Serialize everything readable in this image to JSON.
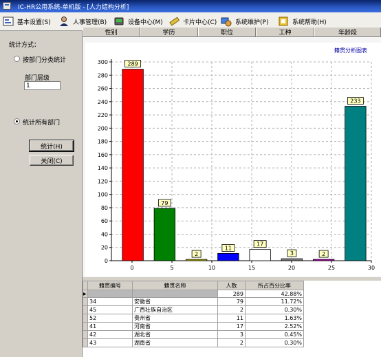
{
  "window": {
    "title": "IC-HR公用系统-单机版 - [人力结构分析]"
  },
  "menu": [
    {
      "label": "基本设置(S)",
      "icon": "settings-icon"
    },
    {
      "label": "人事管理(B)",
      "icon": "person-icon"
    },
    {
      "label": "设备中心(M)",
      "icon": "device-icon"
    },
    {
      "label": "卡片中心(C)",
      "icon": "card-icon"
    },
    {
      "label": "系统维护(P)",
      "icon": "maintenance-icon"
    },
    {
      "label": "系统帮助(H)",
      "icon": "help-icon"
    }
  ],
  "left": {
    "heading": "统计方式：",
    "radio_dept": "按部门分类统计",
    "dept_level_label": "部门层级",
    "dept_level_value": "1",
    "radio_all": "统计所有部门",
    "radio_selected": "all",
    "stat_button": "统计(H)",
    "close_button": "关闭(C)"
  },
  "columns": [
    "性别",
    "学历",
    "职位",
    "工种",
    "年龄段"
  ],
  "chart_data": {
    "type": "bar",
    "title": "籍贯分析图表",
    "x": [
      0,
      5,
      10,
      15,
      20,
      25,
      30
    ],
    "values": [
      289,
      79,
      2,
      11,
      17,
      3,
      2,
      233
    ],
    "colors": [
      "#ff0000",
      "#008000",
      "#c0c000",
      "#0000ff",
      "#ffffff",
      "#808080",
      "#c000c0",
      "#008080"
    ],
    "xticks": [
      0,
      5,
      10,
      15,
      20,
      25,
      30
    ],
    "yticks": [
      0,
      20,
      40,
      60,
      80,
      100,
      120,
      140,
      160,
      180,
      200,
      220,
      240,
      260,
      280,
      300
    ],
    "ylim": [
      0,
      300
    ],
    "grid": true
  },
  "table": {
    "headers": [
      "籍贯编号",
      "籍贯名称",
      "人数",
      "所占百分比率"
    ],
    "rows": [
      [
        "",
        "",
        "289",
        "42.88%"
      ],
      [
        "34",
        "安徽省",
        "79",
        "11.72%"
      ],
      [
        "45",
        "广西壮族自治区",
        "2",
        "0.30%"
      ],
      [
        "52",
        "贵州省",
        "11",
        "1.63%"
      ],
      [
        "41",
        "河南省",
        "17",
        "2.52%"
      ],
      [
        "42",
        "湖北省",
        "3",
        "0.45%"
      ],
      [
        "43",
        "湖南省",
        "2",
        "0.30%"
      ]
    ]
  }
}
